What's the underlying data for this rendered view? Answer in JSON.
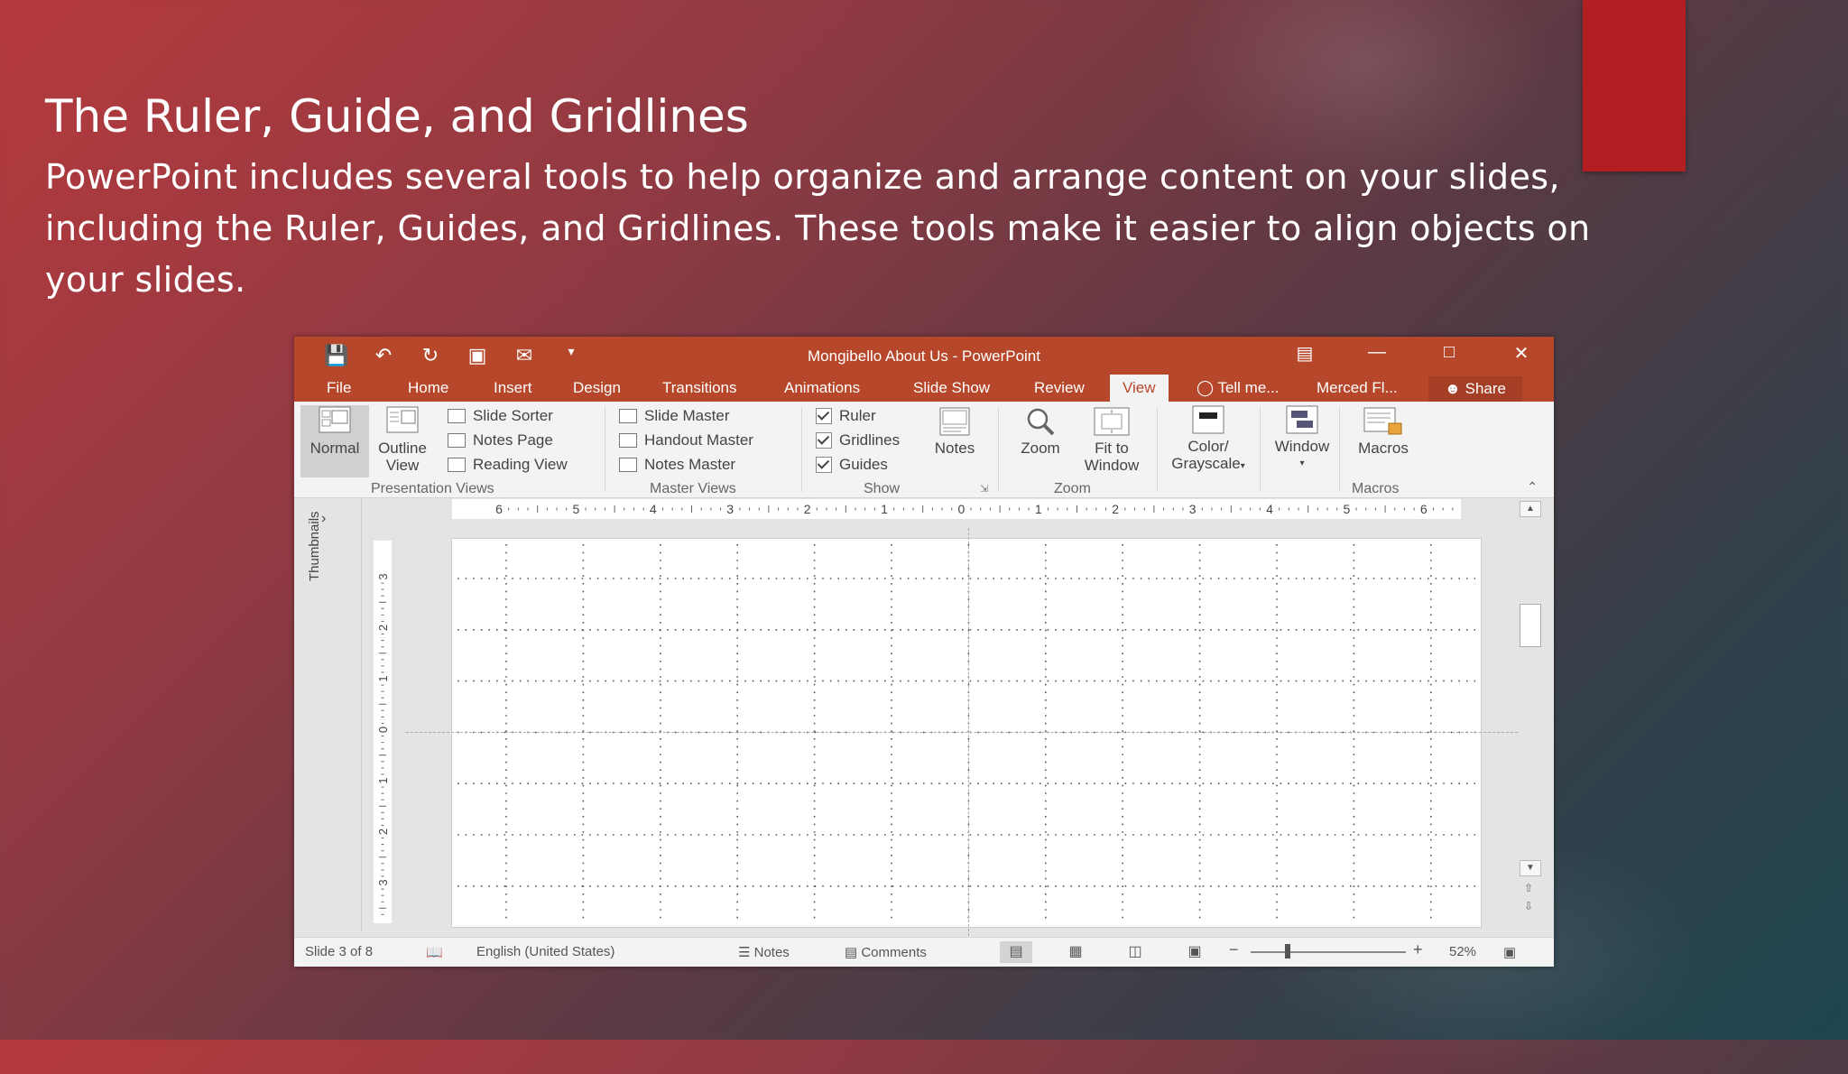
{
  "slide": {
    "title": "The Ruler, Guide, and Gridlines",
    "body": "PowerPoint includes several tools to help organize and arrange content on your slides, including the Ruler, Guides, and Gridlines. These tools make it easier to align objects on your slides."
  },
  "app": {
    "window_title": "Mongibello About Us - PowerPoint",
    "qat": [
      "save-icon",
      "undo-icon",
      "redo-icon",
      "slideshow-icon",
      "email-icon",
      "customize-icon"
    ],
    "tabs": {
      "file": "File",
      "home": "Home",
      "insert": "Insert",
      "design": "Design",
      "transitions": "Transitions",
      "animations": "Animations",
      "slideshow": "Slide Show",
      "review": "Review",
      "view": "View",
      "tellme": "Tell me...",
      "user": "Merced Fl...",
      "share": "Share"
    },
    "ribbon": {
      "normal": "Normal",
      "outline_1": "Outline",
      "outline_2": "View",
      "slide_sorter": "Slide Sorter",
      "notes_page": "Notes Page",
      "reading_view": "Reading View",
      "presentation_views": "Presentation Views",
      "slide_master": "Slide Master",
      "handout_master": "Handout Master",
      "notes_master": "Notes Master",
      "master_views": "Master Views",
      "ruler": "Ruler",
      "gridlines": "Gridlines",
      "guides": "Guides",
      "show": "Show",
      "notes": "Notes",
      "zoom": "Zoom",
      "fit_1": "Fit to",
      "fit_2": "Window",
      "zoom_group": "Zoom",
      "color_1": "Color/",
      "color_2": "Grayscale",
      "window": "Window",
      "macros": "Macros",
      "macros_group": "Macros",
      "checks": {
        "ruler": true,
        "gridlines": true,
        "guides": true
      }
    },
    "pane": {
      "thumbnails": "Thumbnails"
    },
    "ruler_labels": {
      "horizontal": [
        "6",
        "5",
        "4",
        "3",
        "2",
        "1",
        "0",
        "1",
        "2",
        "3",
        "4",
        "5",
        "6"
      ],
      "vertical": [
        "3",
        "2",
        "1",
        "0",
        "1",
        "2",
        "3"
      ]
    },
    "status": {
      "slide": "Slide 3 of 8",
      "language": "English (United States)",
      "notes": "Notes",
      "comments": "Comments",
      "zoom": "52%"
    },
    "colors": {
      "accent": "#b7472a",
      "block": "#b21e21"
    }
  }
}
